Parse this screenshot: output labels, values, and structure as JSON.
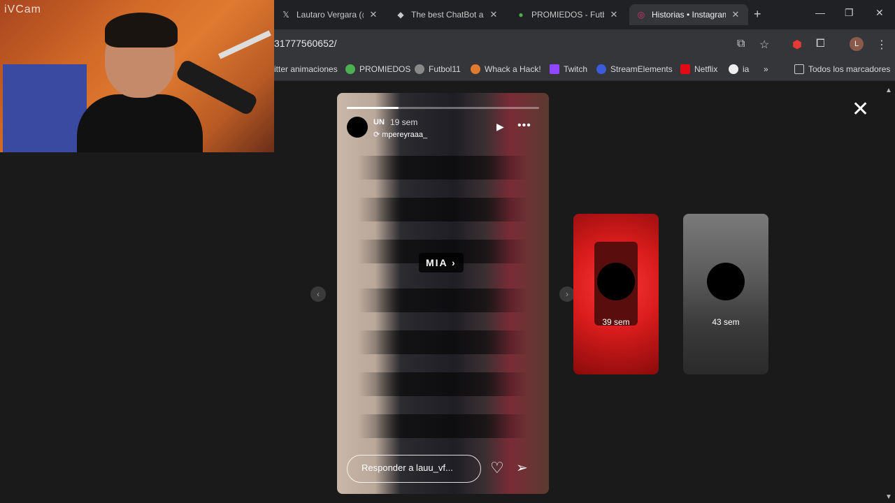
{
  "webcam": {
    "label": "iVCam"
  },
  "tabs": [
    {
      "title": "Lautaro Vergara (@la",
      "icon": "x-icon"
    },
    {
      "title": "The best ChatBot an",
      "icon": "chatbot-icon"
    },
    {
      "title": "PROMIEDOS - Futbol",
      "icon": "promiedos-icon"
    },
    {
      "title": "Historias • Instagram",
      "icon": "instagram-icon",
      "active": true
    }
  ],
  "address": {
    "url": "31777560652/"
  },
  "profile_initial": "L",
  "bookmarks": [
    {
      "label": "itter animaciones"
    },
    {
      "label": "PROMIEDOS"
    },
    {
      "label": "Futbol11"
    },
    {
      "label": "Whack a Hack!"
    },
    {
      "label": "Twitch"
    },
    {
      "label": "StreamElements"
    },
    {
      "label": "Netflix"
    },
    {
      "label": "ia"
    },
    {
      "label": "»"
    },
    {
      "label": "Todos los marcadores"
    }
  ],
  "story": {
    "user": "UN",
    "time": "19 sem",
    "repost_user": "mpereyraaa_",
    "mention": "MIA",
    "reply_placeholder": "Responder a lauu_vf...",
    "progress": 0.27
  },
  "thumbnails": [
    {
      "time": "39 sem"
    },
    {
      "time": "43 sem"
    }
  ],
  "colors": {
    "accent_active_tab": "#35363a",
    "page_bg": "#1a1a1a"
  }
}
